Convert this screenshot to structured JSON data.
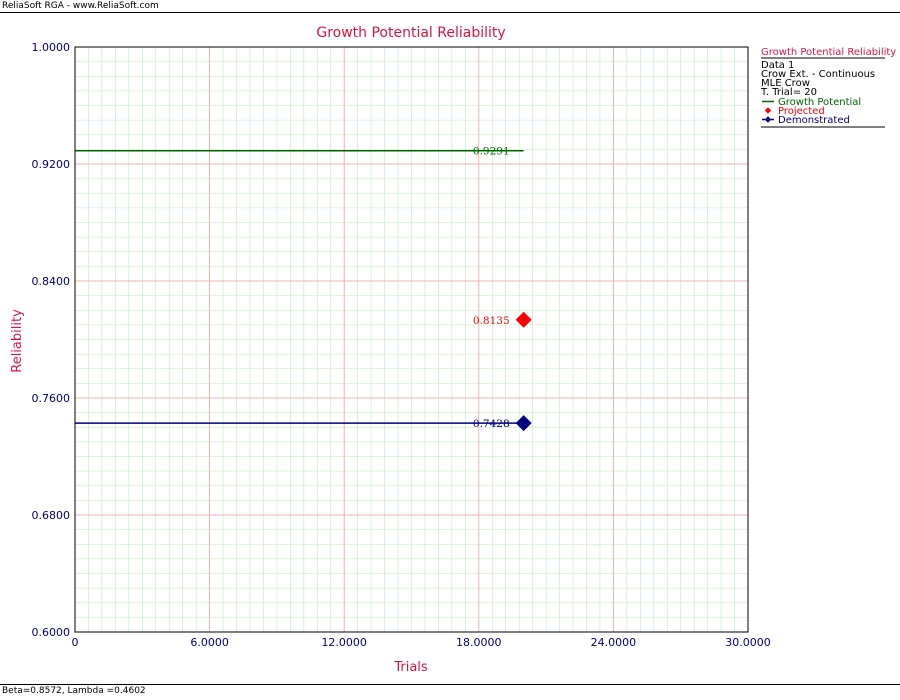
{
  "app": {
    "header_text": "ReliaSoft RGA - www.ReliaSoft.com",
    "footer_text": "Beta=0.8572, Lambda =0.4602"
  },
  "colors": {
    "title": "#dc143c",
    "axis_text": "#000080",
    "grid_major": "#f4a0a0",
    "grid_minor": "#b8f0b8",
    "growth": "#006400",
    "projected": "#ff0000",
    "demonstrated": "#000080"
  },
  "legend": {
    "title": "Growth Potential Reliability",
    "lines": [
      "Data 1",
      "Crow Ext. - Continuous",
      "MLE Crow",
      "T. Trial= 20"
    ],
    "entries": [
      {
        "label": "Growth Potential",
        "marker": "line",
        "color_key": "growth"
      },
      {
        "label": "Projected",
        "marker": "diamond",
        "color_key": "projected"
      },
      {
        "label": "Demonstrated",
        "marker": "line-diamond",
        "color_key": "demonstrated"
      }
    ]
  },
  "chart_data": {
    "type": "line",
    "title": "Growth Potential Reliability",
    "xlabel": "Trials",
    "ylabel": "Reliability",
    "xlim": [
      0,
      30
    ],
    "ylim": [
      0.6,
      1.0
    ],
    "x_ticks": [
      "0",
      "6.0000",
      "12.0000",
      "18.0000",
      "24.0000",
      "30.0000"
    ],
    "y_ticks": [
      "0.6000",
      "0.6800",
      "0.7600",
      "0.8400",
      "0.9200",
      "1.0000"
    ],
    "x_tick_values": [
      0,
      6,
      12,
      18,
      24,
      30
    ],
    "y_tick_values": [
      0.6,
      0.68,
      0.76,
      0.84,
      0.92,
      1.0
    ],
    "grid": true,
    "legend_position": "right",
    "series": [
      {
        "name": "Growth Potential",
        "kind": "hline",
        "x": [
          0,
          20
        ],
        "y": 0.9291,
        "label": "0.9291",
        "color_key": "growth"
      },
      {
        "name": "Projected",
        "kind": "point",
        "x": 20,
        "y": 0.8135,
        "label": "0.8135",
        "color_key": "projected"
      },
      {
        "name": "Demonstrated",
        "kind": "hline-point",
        "x": [
          0,
          20
        ],
        "y": 0.7428,
        "label": "0.7428",
        "color_key": "demonstrated"
      }
    ]
  }
}
